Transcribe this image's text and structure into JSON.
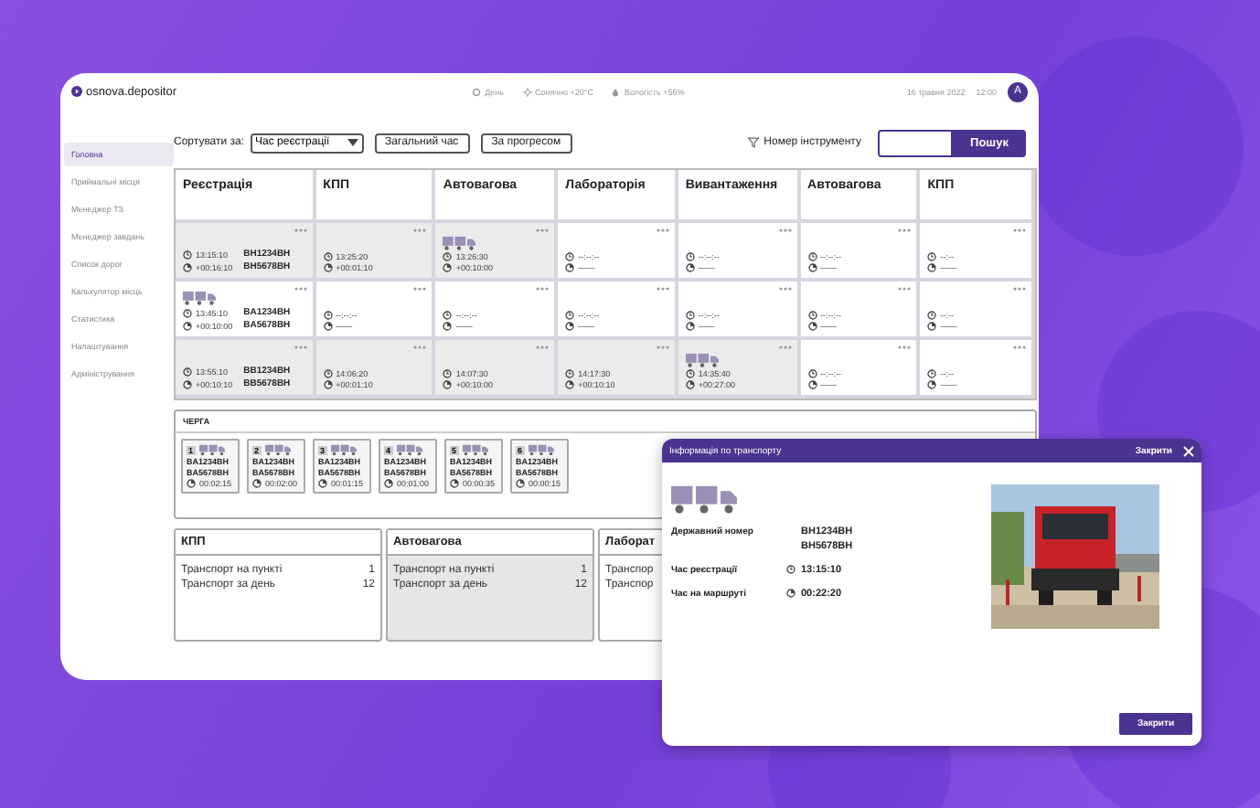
{
  "header": {
    "logo": "osnova.depositor",
    "weather": [
      {
        "kind": "day",
        "text": "День"
      },
      {
        "kind": "sun",
        "text": "Сонячно +20°C"
      },
      {
        "kind": "humidity",
        "text": "Вологість +56%"
      }
    ],
    "date": "16 травня 2022",
    "time": "12:00",
    "avatar": "A"
  },
  "sidebar": {
    "items": [
      {
        "label": "Головна",
        "selected": true
      },
      {
        "label": "Приймальні місця",
        "selected": false
      },
      {
        "label": "Менеджер ТЗ",
        "selected": false
      },
      {
        "label": "Менеджер завдань",
        "selected": false
      },
      {
        "label": "Список дорог",
        "selected": false
      },
      {
        "label": "Калькулятор місць",
        "selected": false
      },
      {
        "label": "Статистика",
        "selected": false
      },
      {
        "label": "Налаштування",
        "selected": false
      },
      {
        "label": "Адміністрування",
        "selected": false
      }
    ]
  },
  "toolbar": {
    "sort_label": "Сортувати за:",
    "sort_value": "Час реєстрації",
    "buttons": [
      "Загальний час",
      "За прогресом"
    ],
    "filter_label": "Номер інструменту",
    "search_button": "Пошук"
  },
  "table": {
    "columns": [
      "Реєстрація",
      "КПП",
      "Автовагова",
      "Лабораторія",
      "Вивантаження",
      "Автовагова",
      "КПП"
    ],
    "rows": [
      {
        "cells": [
          {
            "active": true,
            "truck": false,
            "time": "13:15:10",
            "offset": "+00:16:10",
            "plates": [
              "BH1234BH",
              "BH5678BH"
            ]
          },
          {
            "active": true,
            "truck": false,
            "time": "13:25:20",
            "offset": "+00:01:10"
          },
          {
            "active": true,
            "truck": true,
            "time": "13:26:30",
            "offset": "+00:10:00"
          },
          {
            "active": false,
            "truck": false,
            "time": "--:--:--",
            "offset": "——"
          },
          {
            "active": false,
            "truck": false,
            "time": "--:--:--",
            "offset": "——"
          },
          {
            "active": false,
            "truck": false,
            "time": "--:--:--",
            "offset": "——"
          },
          {
            "active": false,
            "truck": false,
            "time": "--:--",
            "offset": "——"
          }
        ]
      },
      {
        "cells": [
          {
            "active": false,
            "truck": true,
            "time": "13:45:10",
            "offset": "+00:10:00",
            "plates": [
              "BA1234BH",
              "BA5678BH"
            ]
          },
          {
            "active": false,
            "truck": false,
            "time": "--:--:--",
            "offset": "——"
          },
          {
            "active": false,
            "truck": false,
            "time": "--:--:--",
            "offset": "——"
          },
          {
            "active": false,
            "truck": false,
            "time": "--:--:--",
            "offset": "——"
          },
          {
            "active": false,
            "truck": false,
            "time": "--:--:--",
            "offset": "——"
          },
          {
            "active": false,
            "truck": false,
            "time": "--:--:--",
            "offset": "——"
          },
          {
            "active": false,
            "truck": false,
            "time": "--:--",
            "offset": "——"
          }
        ]
      },
      {
        "cells": [
          {
            "active": true,
            "truck": false,
            "time": "13:55:10",
            "offset": "+00:10:10",
            "plates": [
              "BB1234BH",
              "BB5678BH"
            ]
          },
          {
            "active": true,
            "truck": false,
            "time": "14:06:20",
            "offset": "+00:01:10"
          },
          {
            "active": true,
            "truck": false,
            "time": "14:07:30",
            "offset": "+00:10:00"
          },
          {
            "active": true,
            "truck": false,
            "time": "14:17:30",
            "offset": "+00:10:10"
          },
          {
            "active": true,
            "truck": true,
            "time": "14:35:40",
            "offset": "+00:27:00"
          },
          {
            "active": false,
            "truck": false,
            "time": "--:--:--",
            "offset": "——"
          },
          {
            "active": false,
            "truck": false,
            "time": "--:--",
            "offset": "——"
          }
        ]
      }
    ]
  },
  "queue": {
    "title": "ЧЕРГА",
    "items": [
      {
        "number": "1",
        "plates": [
          "BA1234BH",
          "BA5678BH"
        ],
        "time": "00:02:15"
      },
      {
        "number": "2",
        "plates": [
          "BA1234BH",
          "BA5678BH"
        ],
        "time": "00:02:00"
      },
      {
        "number": "3",
        "plates": [
          "BA1234BH",
          "BA5678BH"
        ],
        "time": "00:01:15"
      },
      {
        "number": "4",
        "plates": [
          "BA1234BH",
          "BA5678BH"
        ],
        "time": "00:01:00"
      },
      {
        "number": "5",
        "plates": [
          "BA1234BH",
          "BA5678BH"
        ],
        "time": "00:00:35"
      },
      {
        "number": "6",
        "plates": [
          "BA1234BH",
          "BA5678BH"
        ],
        "time": "00:00:15"
      }
    ]
  },
  "stats": [
    {
      "title": "КПП",
      "shaded": false,
      "rows": [
        {
          "label": "Транспорт на пункті",
          "value": "1"
        },
        {
          "label": "Транспорт за день",
          "value": "12"
        }
      ]
    },
    {
      "title": "Автовагова",
      "shaded": true,
      "rows": [
        {
          "label": "Транспорт на пункті",
          "value": "1"
        },
        {
          "label": "Транспорт за день",
          "value": "12"
        }
      ]
    },
    {
      "title": "Лаборат",
      "shaded": false,
      "rows": [
        {
          "label": "Транспор"
        },
        {
          "label": "Транспор"
        }
      ]
    }
  ],
  "popup": {
    "title": "Інформація по транспорту",
    "close_link": "Закрити",
    "fields": [
      {
        "kind": "plates",
        "label": "Державний номер",
        "values": [
          "BH1234BH",
          "BH5678BH"
        ]
      },
      {
        "kind": "clock",
        "label": "Час реєстрації",
        "values": [
          "13:15:10"
        ]
      },
      {
        "kind": "timer",
        "label": "Час на маршруті",
        "values": [
          "00:22:20"
        ]
      }
    ],
    "button": "Закрити"
  }
}
